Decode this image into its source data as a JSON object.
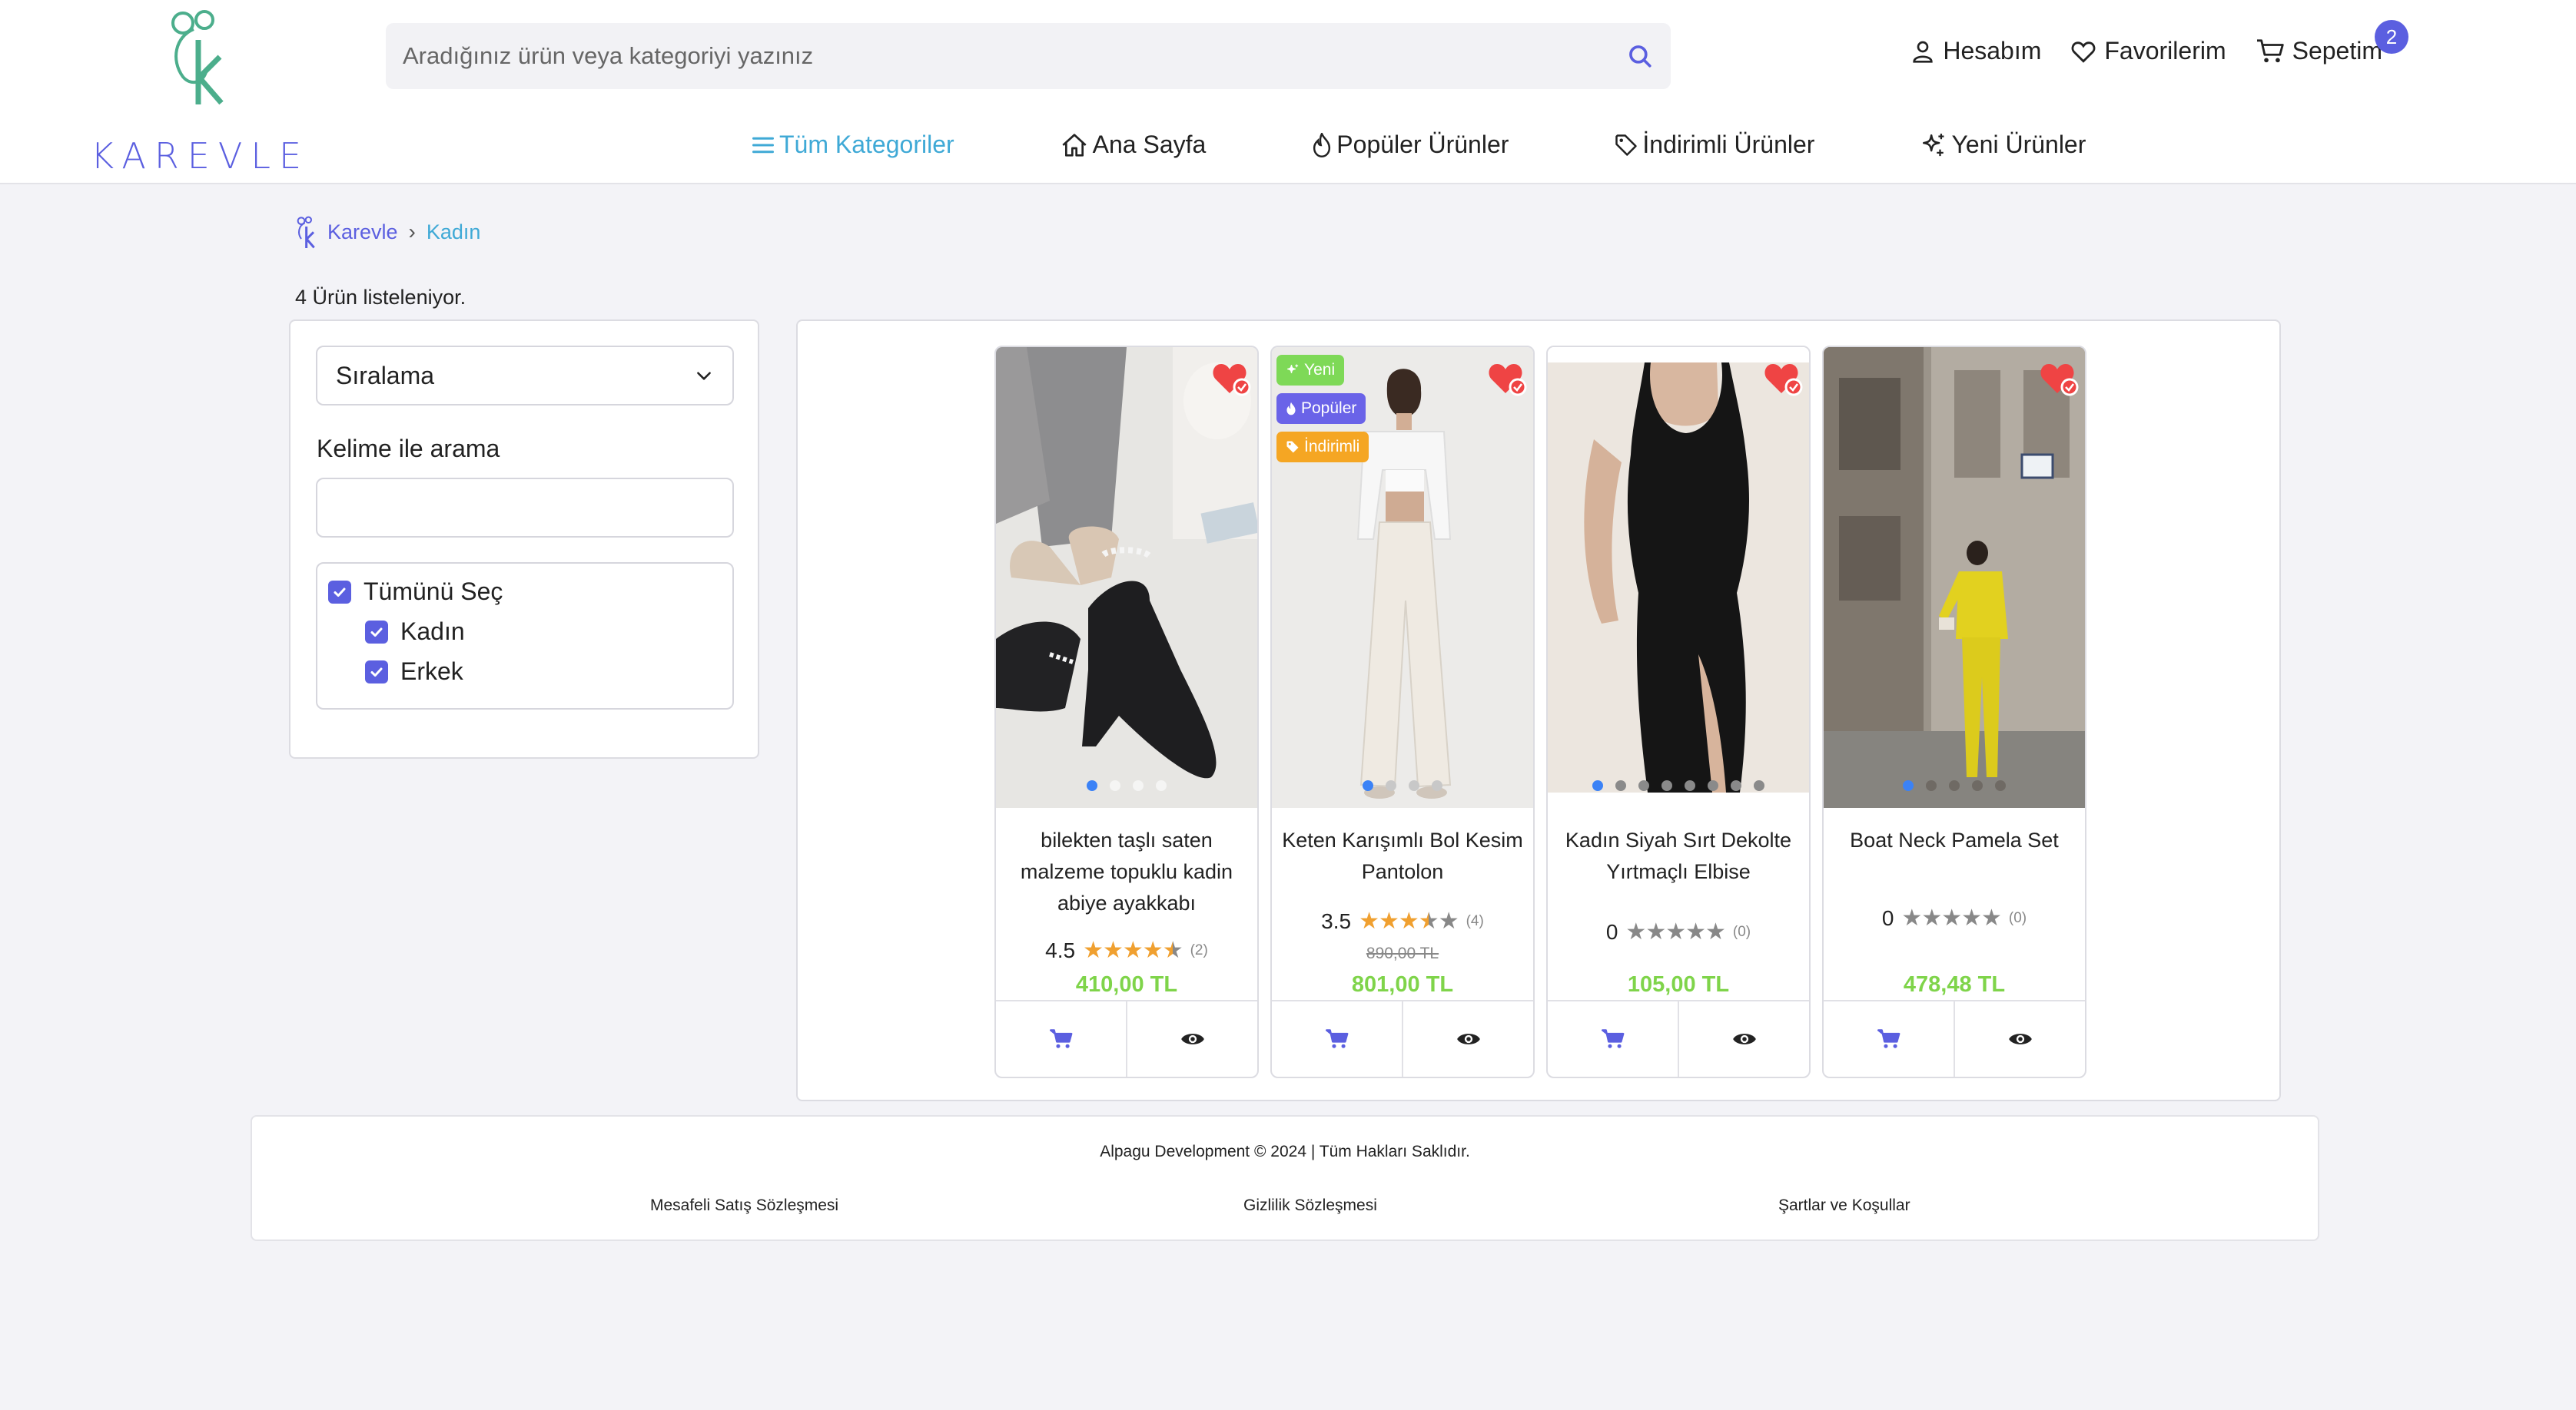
{
  "brand": {
    "name": "KAREVLE",
    "logo_icon": "koala-k-icon"
  },
  "search": {
    "placeholder": "Aradığınız ürün veya kategoriyi yazınız"
  },
  "top_actions": {
    "account": "Hesabım",
    "favorites": "Favorilerim",
    "cart": "Sepetim",
    "cart_count": "2"
  },
  "nav": {
    "all_categories": "Tüm Kategoriler",
    "home": "Ana Sayfa",
    "popular": "Popüler Ürünler",
    "discounted": "İndirimli Ürünler",
    "new": "Yeni Ürünler"
  },
  "breadcrumb": {
    "home": "Karevle",
    "current": "Kadın"
  },
  "listing_count": "4 Ürün listeleniyor.",
  "filters": {
    "sort_label": "Sıralama",
    "keyword_label": "Kelime ile arama",
    "keyword_value": "",
    "select_all": "Tümünü Seç",
    "categories": [
      "Kadın",
      "Erkek"
    ]
  },
  "products": [
    {
      "title": "bilekten taşlı saten malzeme topuklu kadin abiye ayakkabı",
      "rating": "4.5",
      "stars": 4.5,
      "review_count": "(2)",
      "old_price": "",
      "price": "410,00 TL",
      "tags": [],
      "image_count": 4
    },
    {
      "title": "Keten Karışımlı Bol Kesim Pantolon",
      "rating": "3.5",
      "stars": 3.5,
      "review_count": "(4)",
      "old_price": "890,00 TL",
      "price": "801,00 TL",
      "tags": [
        "Yeni",
        "Popüler",
        "İndirimli"
      ],
      "image_count": 4
    },
    {
      "title": "Kadın Siyah Sırt Dekolte Yırtmaçlı Elbise",
      "rating": "0",
      "stars": 0,
      "review_count": "(0)",
      "old_price": "",
      "price": "105,00 TL",
      "tags": [],
      "image_count": 8
    },
    {
      "title": "Boat Neck Pamela Set",
      "rating": "0",
      "stars": 0,
      "review_count": "(0)",
      "old_price": "",
      "price": "478,48 TL",
      "tags": [],
      "image_count": 5
    }
  ],
  "footer": {
    "copyright": "Alpagu Development © 2024 | Tüm Hakları Saklıdır.",
    "links": [
      "Mesafeli Satış Sözleşmesi",
      "Gizlilik Sözleşmesi",
      "Şartlar ve Koşullar"
    ]
  },
  "colors": {
    "accent": "#5b5fe0",
    "nav_active": "#3fa9d6",
    "price": "#7fd44a",
    "star": "#f0a030",
    "tag_new": "#7ed957",
    "tag_popular": "#6a63e8",
    "tag_discount": "#f5a623"
  }
}
